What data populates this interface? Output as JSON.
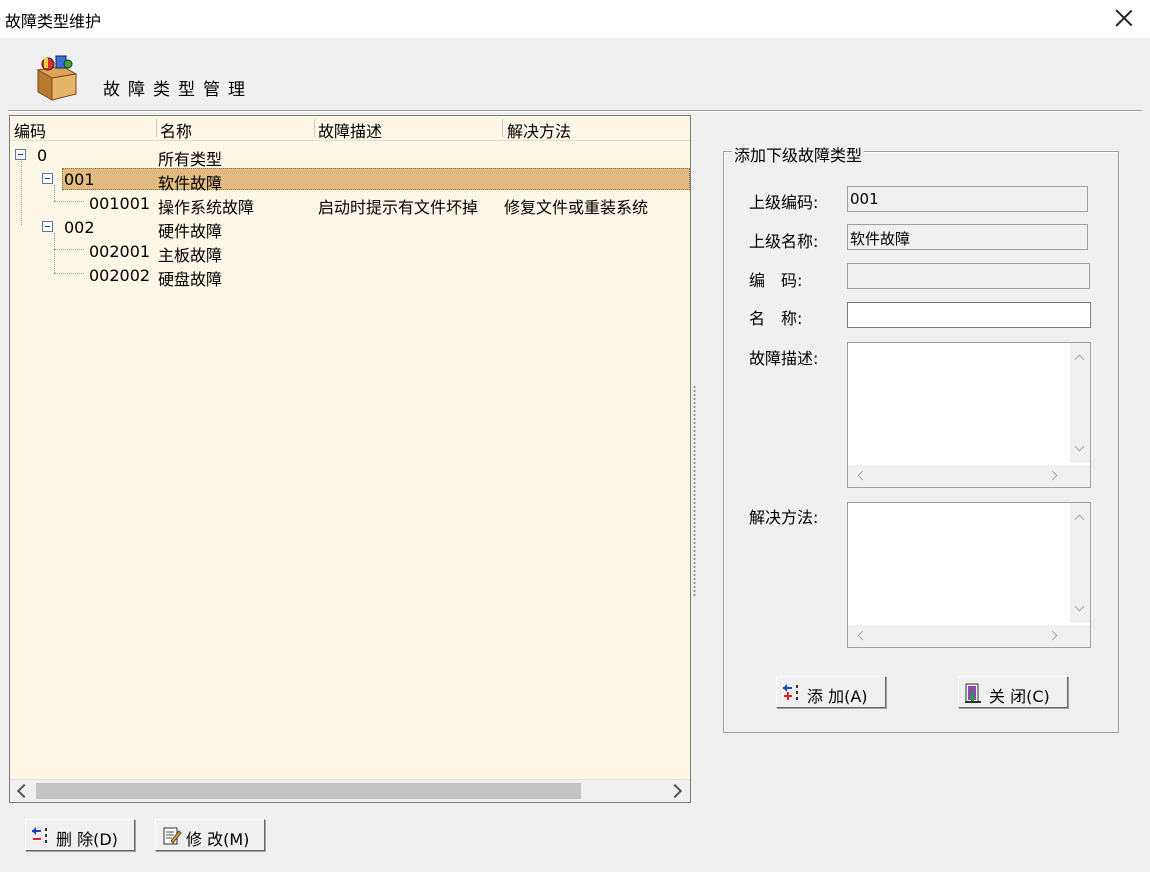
{
  "window": {
    "title": "故障类型维护"
  },
  "header": {
    "title": "故障类型管理"
  },
  "tree": {
    "columns": [
      "编码",
      "名称",
      "故障描述",
      "解决方法"
    ],
    "rows": [
      {
        "code": "0",
        "name": "所有类型",
        "desc": "",
        "solution": ""
      },
      {
        "code": "001",
        "name": "软件故障",
        "desc": "",
        "solution": ""
      },
      {
        "code": "001001",
        "name": "操作系统故障",
        "desc": "启动时提示有文件坏掉",
        "solution": "修复文件或重装系统"
      },
      {
        "code": "002",
        "name": "硬件故障",
        "desc": "",
        "solution": ""
      },
      {
        "code": "002001",
        "name": "主板故障",
        "desc": "",
        "solution": ""
      },
      {
        "code": "002002",
        "name": "硬盘故障",
        "desc": "",
        "solution": ""
      }
    ],
    "selected_index": 1
  },
  "form": {
    "group_title": "添加下级故障类型",
    "parent_code_label": "上级编码:",
    "parent_code_value": "001",
    "parent_name_label": "上级名称:",
    "parent_name_value": "软件故障",
    "code_label": "编　码:",
    "code_value": "",
    "name_label": "名　称:",
    "name_value": "",
    "desc_label": "故障描述:",
    "solution_label": "解决方法:"
  },
  "buttons": {
    "add": "添 加(A)",
    "close": "关 闭(C)",
    "delete": "删 除(D)",
    "modify": "修 改(M)"
  }
}
